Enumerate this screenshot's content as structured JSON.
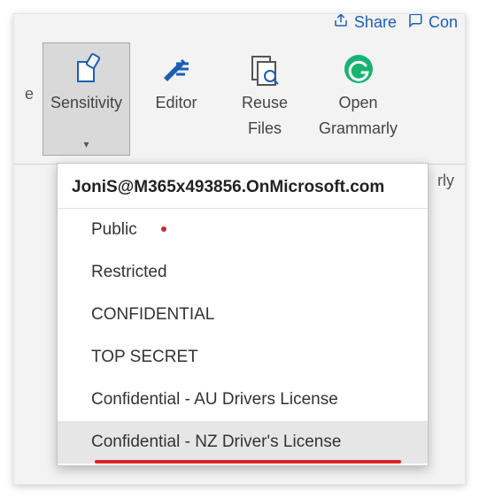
{
  "topbar": {
    "share": {
      "label": "Share"
    },
    "comments": {
      "label_partial": "Con"
    }
  },
  "ribbon": {
    "left_partial": "e",
    "sensitivity": {
      "label": "Sensitivity"
    },
    "editor": {
      "label": "Editor"
    },
    "reuse_files": {
      "line1": "Reuse",
      "line2": "Files"
    },
    "grammarly": {
      "line1": "Open",
      "line2": "Grammarly",
      "cutoff": "rly"
    }
  },
  "dropdown": {
    "account": "JoniS@M365x493856.OnMicrosoft.com",
    "items": [
      {
        "label": "Public"
      },
      {
        "label": "Restricted"
      },
      {
        "label": "CONFIDENTIAL"
      },
      {
        "label": "TOP SECRET"
      },
      {
        "label": "Confidential - AU Drivers License"
      },
      {
        "label": "Confidential - NZ Driver's License"
      }
    ]
  }
}
